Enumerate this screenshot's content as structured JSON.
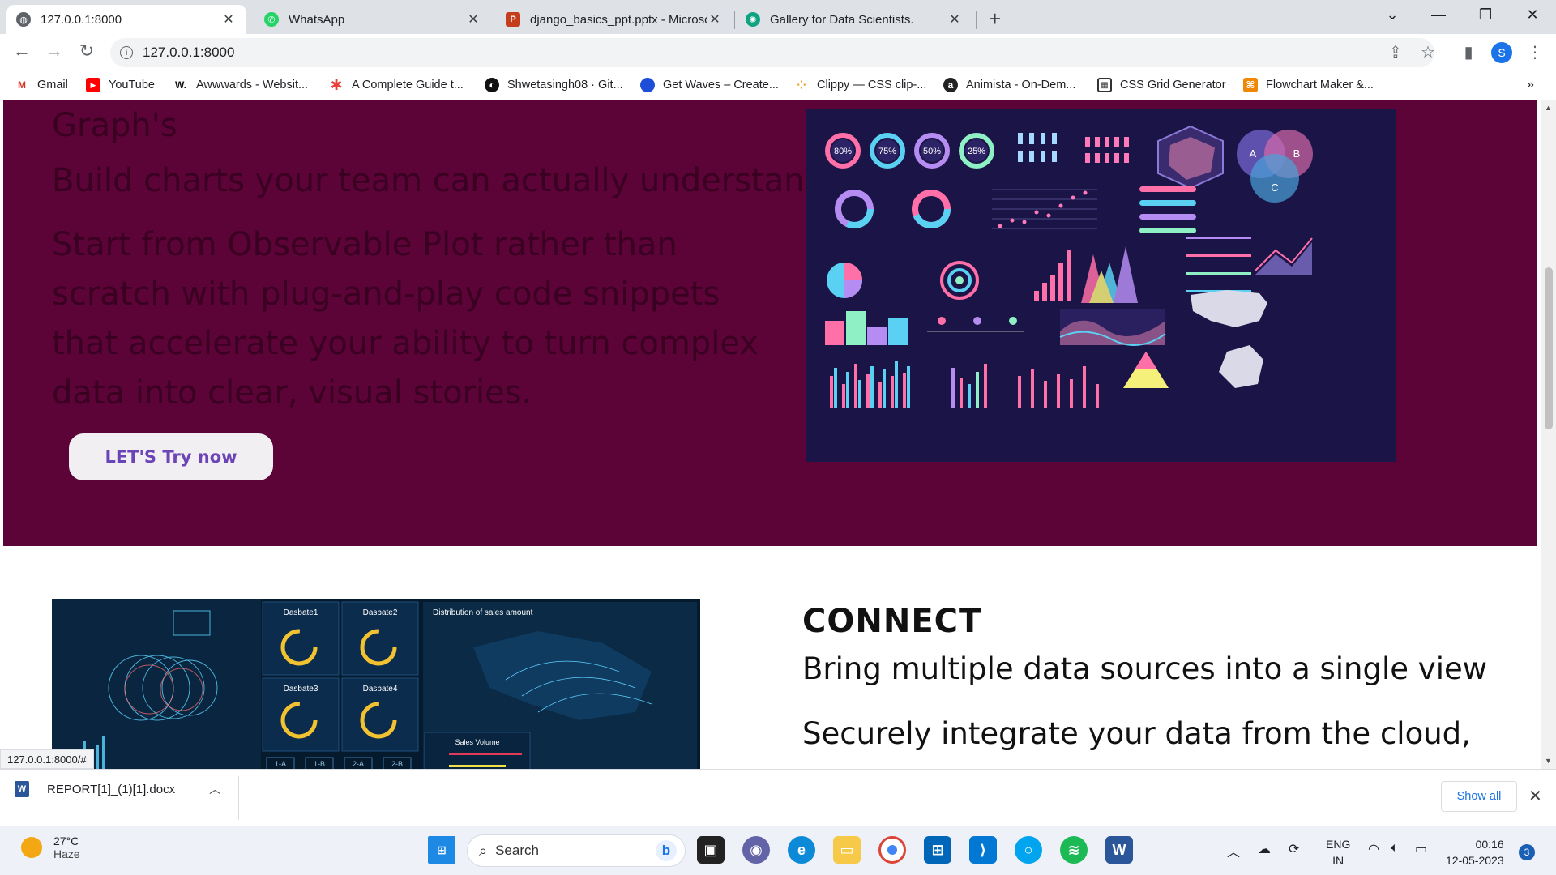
{
  "tabs": [
    {
      "title": "127.0.0.1:8000",
      "icon": "globe-icon",
      "color": "#5f6368"
    },
    {
      "title": "WhatsApp",
      "icon": "whatsapp-icon",
      "color": "#25d366"
    },
    {
      "title": "django_basics_ppt.pptx - Microsо",
      "icon": "powerpoint-icon",
      "color": "#c43e1c"
    },
    {
      "title": "Gallery for Data Scientists.",
      "icon": "chatgpt-icon",
      "color": "#10a37f"
    }
  ],
  "address": {
    "url": "127.0.0.1:8000"
  },
  "profile": {
    "initial": "S"
  },
  "bookmarks": [
    {
      "label": "Gmail",
      "icon": "gmail-icon"
    },
    {
      "label": "YouTube",
      "icon": "youtube-icon"
    },
    {
      "label": "Awwwards - Websit...",
      "icon": "awwwards-icon"
    },
    {
      "label": "A Complete Guide t...",
      "icon": "asterisk-icon"
    },
    {
      "label": "Shwetasingh08 · Git...",
      "icon": "github-icon"
    },
    {
      "label": "Get Waves – Create...",
      "icon": "waves-icon"
    },
    {
      "label": "Clippy — CSS clip-...",
      "icon": "clippy-icon"
    },
    {
      "label": "Animista - On-Dem...",
      "icon": "animista-icon"
    },
    {
      "label": "CSS Grid Generator",
      "icon": "grid-icon"
    },
    {
      "label": "Flowchart Maker &...",
      "icon": "flowchart-icon"
    }
  ],
  "hero": {
    "title": "Graph's",
    "subtitle": "Build charts your team can actually understand",
    "description": "Start from Observable Plot rather than scratch with plug-and-play code snippets that accelerate your ability to turn complex data into clear, visual stories.",
    "button": "LET'S Try now",
    "colors": {
      "background": "#5c0337",
      "button_text": "#6b45b8"
    }
  },
  "infographic": {
    "donuts": [
      "80%",
      "75%",
      "50%",
      "25%"
    ],
    "venn": [
      "A",
      "B",
      "C"
    ]
  },
  "dashboard": {
    "panels": [
      "Dasbate1",
      "Dasbate2",
      "Dasbate3",
      "Dasbate4"
    ],
    "map_title": "Distribution of sales amount",
    "sales_title": "Sales Volume",
    "buttons": [
      "1-A",
      "1-B",
      "2-A",
      "2-B"
    ]
  },
  "connect": {
    "title": "CONNECT",
    "subtitle": "Bring multiple data sources into a single view",
    "description": "Securely integrate your data from the cloud,"
  },
  "status": {
    "url": "127.0.0.1:8000/#"
  },
  "download": {
    "filename": "REPORT[1]_(1)[1].docx",
    "show_all": "Show all"
  },
  "taskbar": {
    "temp": "27°C",
    "weather": "Haze",
    "search": "Search",
    "lang1": "ENG",
    "lang2": "IN",
    "time": "00:16",
    "date": "12-05-2023",
    "notifications": "3"
  }
}
